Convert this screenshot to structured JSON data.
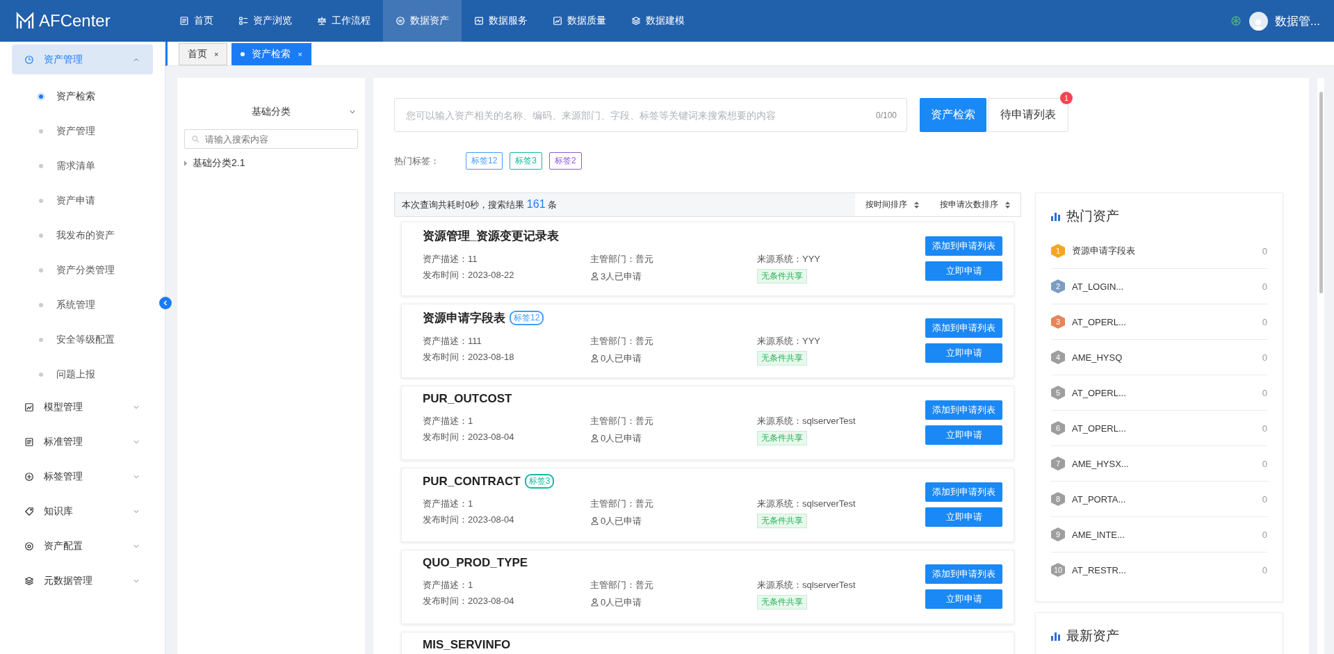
{
  "header": {
    "logo": "AFCenter",
    "nav": [
      {
        "label": "首页",
        "selected": false
      },
      {
        "label": "资产浏览",
        "selected": false
      },
      {
        "label": "工作流程",
        "selected": false
      },
      {
        "label": "数据资产",
        "selected": true
      },
      {
        "label": "数据服务",
        "selected": false
      },
      {
        "label": "数据质量",
        "selected": false
      },
      {
        "label": "数据建模",
        "selected": false
      }
    ],
    "user": "数据管..."
  },
  "sidebar": {
    "groups": [
      {
        "label": "资产管理",
        "expanded": true,
        "selected": true,
        "children": [
          {
            "label": "资产检索",
            "selected": true
          },
          {
            "label": "资产管理",
            "selected": false
          },
          {
            "label": "需求清单",
            "selected": false
          },
          {
            "label": "资产申请",
            "selected": false
          },
          {
            "label": "我发布的资产",
            "selected": false
          },
          {
            "label": "资产分类管理",
            "selected": false
          },
          {
            "label": "系统管理",
            "selected": false
          },
          {
            "label": "安全等级配置",
            "selected": false
          },
          {
            "label": "问题上报",
            "selected": false
          }
        ]
      },
      {
        "label": "模型管理",
        "expanded": false,
        "selected": false
      },
      {
        "label": "标准管理",
        "expanded": false,
        "selected": false
      },
      {
        "label": "标签管理",
        "expanded": false,
        "selected": false
      },
      {
        "label": "知识库",
        "expanded": false,
        "selected": false
      },
      {
        "label": "资产配置",
        "expanded": false,
        "selected": false
      },
      {
        "label": "元数据管理",
        "expanded": false,
        "selected": false
      }
    ]
  },
  "tabs": [
    {
      "label": "首页",
      "close": "×",
      "selected": false
    },
    {
      "label": "资产检索",
      "close": "×",
      "selected": true
    }
  ],
  "tree_panel": {
    "title": "基础分类",
    "placeholder": "请输入搜索内容",
    "nodes": [
      {
        "label": "基础分类2.1",
        "expanded": false
      }
    ]
  },
  "search": {
    "placeholder": "您可以输入资产相关的名称、编码、来源部门、字段、标签等关键词来搜索想要的内容",
    "counter": "0/100",
    "search_button": "资产检索",
    "list_button": "待申请列表",
    "list_badge": "1"
  },
  "hot_tags": {
    "label": "热门标签：",
    "tags": [
      {
        "label": "标签12",
        "color": "#409eff"
      },
      {
        "label": "标签3",
        "color": "#13b9a0"
      },
      {
        "label": "标签2",
        "color": "#8e5bd0"
      }
    ]
  },
  "result_bar": {
    "prefix": "本次查询共耗时0秒，搜索结果",
    "count": "161",
    "suffix": "条",
    "sorts": [
      "按时间排序",
      "按申请次数排序"
    ]
  },
  "results": [
    {
      "title": "资源管理_资源变更记录表",
      "description": "资产描述：11",
      "department": "主管部门：普元",
      "system": "来源系统：YYY",
      "published": "发布时间：2023-08-22",
      "applicants": "3人已申请",
      "share": "无条件共享",
      "add_button": "添加到申请列表",
      "apply_button": "立即申请"
    },
    {
      "title": "资源申请字段表",
      "tag": {
        "label": "标签12",
        "color": "#409eff"
      },
      "description": "资产描述：111",
      "department": "主管部门：普元",
      "system": "来源系统：YYY",
      "published": "发布时间：2023-08-18",
      "applicants": "0人已申请",
      "share": "无条件共享",
      "add_button": "添加到申请列表",
      "apply_button": "立即申请"
    },
    {
      "title": "PUR_OUTCOST",
      "description": "资产描述：1",
      "department": "主管部门：普元",
      "system": "来源系统：sqlserverTest",
      "published": "发布时间：2023-08-04",
      "applicants": "0人已申请",
      "share": "无条件共享",
      "add_button": "添加到申请列表",
      "apply_button": "立即申请"
    },
    {
      "title": "PUR_CONTRACT",
      "tag": {
        "label": "标签3",
        "color": "#13b9a0"
      },
      "description": "资产描述：1",
      "department": "主管部门：普元",
      "system": "来源系统：sqlserverTest",
      "published": "发布时间：2023-08-04",
      "applicants": "0人已申请",
      "share": "无条件共享",
      "add_button": "添加到申请列表",
      "apply_button": "立即申请"
    },
    {
      "title": "QUO_PROD_TYPE",
      "description": "资产描述：1",
      "department": "主管部门：普元",
      "system": "来源系统：sqlserverTest",
      "published": "发布时间：2023-08-04",
      "applicants": "0人已申请",
      "share": "无条件共享",
      "add_button": "添加到申请列表",
      "apply_button": "立即申请"
    },
    {
      "title": "MIS_SERVINFO"
    }
  ],
  "hot_assets": {
    "title": "热门资产",
    "items": [
      {
        "rank": "1",
        "name": "资源申请字段表",
        "count": "0",
        "color": "#f5a623"
      },
      {
        "rank": "2",
        "name": "AT_LOGIN...",
        "count": "0",
        "color": "#7d9cc4"
      },
      {
        "rank": "3",
        "name": "AT_OPERL...",
        "count": "0",
        "color": "#e8845a"
      },
      {
        "rank": "4",
        "name": "AME_HYSQ",
        "count": "0",
        "color": "#9e9e9e"
      },
      {
        "rank": "5",
        "name": "AT_OPERL...",
        "count": "0",
        "color": "#9e9e9e"
      },
      {
        "rank": "6",
        "name": "AT_OPERL...",
        "count": "0",
        "color": "#9e9e9e"
      },
      {
        "rank": "7",
        "name": "AME_HYSX...",
        "count": "0",
        "color": "#9e9e9e"
      },
      {
        "rank": "8",
        "name": "AT_PORTA...",
        "count": "0",
        "color": "#9e9e9e"
      },
      {
        "rank": "9",
        "name": "AME_INTE...",
        "count": "0",
        "color": "#9e9e9e"
      },
      {
        "rank": "10",
        "name": "AT_RESTR...",
        "count": "0",
        "color": "#9e9e9e"
      }
    ]
  },
  "latest_assets": {
    "title": "最新资产"
  }
}
